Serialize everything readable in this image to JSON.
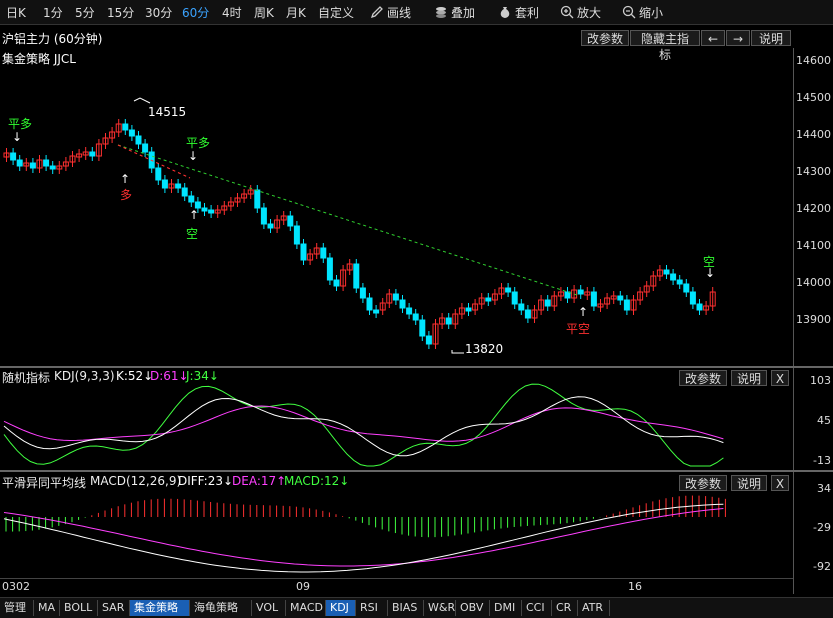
{
  "toolbar": {
    "periods": [
      "日K",
      "1分",
      "5分",
      "15分",
      "30分",
      "60分",
      "4时",
      "周K",
      "月K",
      "自定义"
    ],
    "active_period": "60分",
    "tools": [
      {
        "label": "画线",
        "icon": "pencil-icon"
      },
      {
        "label": "叠加",
        "icon": "layers-icon"
      },
      {
        "label": "套利",
        "icon": "money-bag-icon"
      },
      {
        "label": "放大",
        "icon": "zoom-in-icon"
      },
      {
        "label": "缩小",
        "icon": "zoom-out-icon"
      }
    ]
  },
  "main": {
    "title": "沪铝主力 (60分钟)",
    "buttons": [
      "改参数",
      "隐藏主指标",
      "←",
      "→",
      "说明"
    ],
    "strategy_label": "集金策略 JJCL",
    "price_ticks": [
      "14600",
      "14500",
      "14400",
      "14300",
      "14200",
      "14100",
      "14000",
      "13900"
    ],
    "high_label": "14515",
    "low_label": "13820",
    "signals": [
      "平多",
      "多",
      "平多",
      "空",
      "空",
      "平空"
    ]
  },
  "kdj": {
    "title": "随机指标",
    "name": "KDJ(9,3,3)",
    "k": "K:52↓",
    "d": "D:61↓",
    "j": "J:34↓",
    "buttons": [
      "改参数",
      "说明",
      "X"
    ],
    "ticks": [
      "103",
      "45",
      "-13"
    ]
  },
  "macd": {
    "title": "平滑异同平均线",
    "name": "MACD(12,26,9)",
    "diff": "DIFF:23↓",
    "dea": "DEA:17↑",
    "macd": "MACD:12↓",
    "buttons": [
      "改参数",
      "说明",
      "X"
    ],
    "ticks": [
      "34",
      "-29",
      "-92"
    ]
  },
  "dates": [
    "0302",
    "09",
    "16"
  ],
  "bottom_tabs": [
    "管理",
    "MA",
    "BOLL",
    "SAR",
    "集金策略",
    "海龟策略",
    "VOL",
    "MACD",
    "KDJ",
    "RSI",
    "BIAS",
    "W&R",
    "OBV",
    "DMI",
    "CCI",
    "CR",
    "ATR"
  ],
  "active_tabs": [
    "集金策略",
    "KDJ"
  ],
  "colors": {
    "up": "#ff3030",
    "down": "#00e5ff",
    "k": "#ffffff",
    "d": "#ff40ff",
    "j": "#40ff40",
    "dea": "#ff40ff",
    "signal_green": "#30ff30",
    "signal_red": "#ff3030"
  }
}
